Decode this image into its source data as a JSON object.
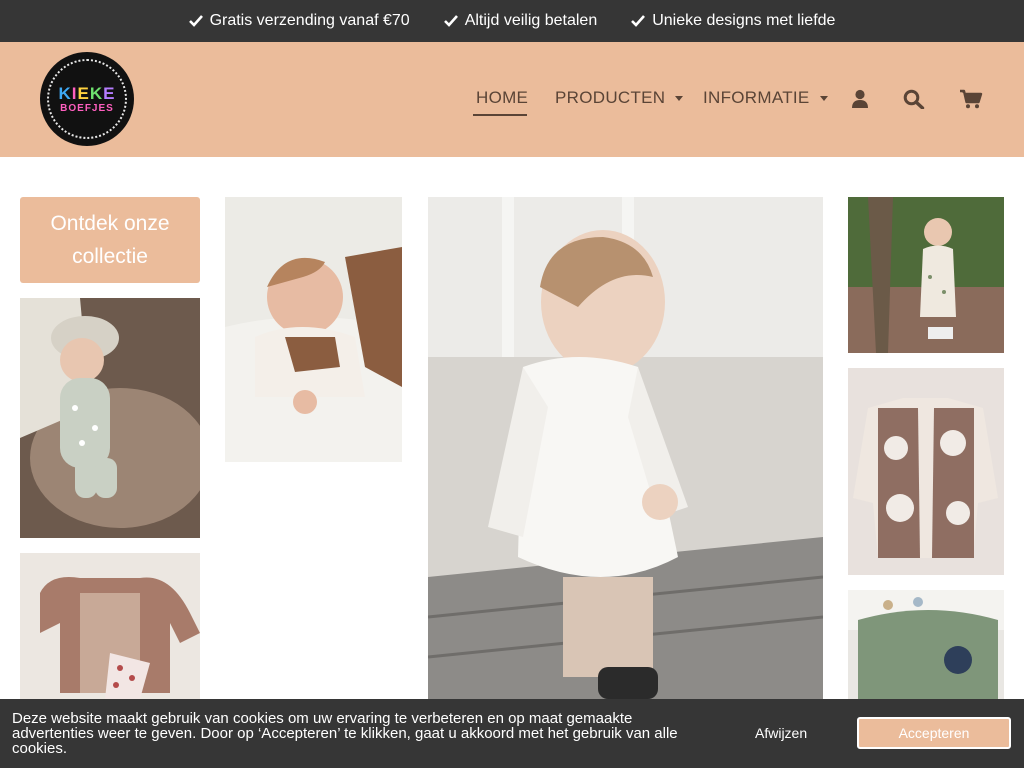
{
  "topbar": {
    "usps": [
      {
        "label": "Gratis verzending vanaf €70",
        "icon": "check-icon"
      },
      {
        "label": "Altijd veilig betalen",
        "icon": "check-icon"
      },
      {
        "label": "Unieke designs met liefde",
        "icon": "check-icon"
      }
    ]
  },
  "header": {
    "logo": {
      "line1": "KIEKE",
      "line2": "BOEFJES"
    },
    "nav": [
      {
        "label": "HOME",
        "active": true
      },
      {
        "label": "PRODUCTEN",
        "has_dropdown": true
      },
      {
        "label": "INFORMATIE",
        "has_dropdown": true
      }
    ],
    "icons": [
      "user-icon",
      "search-icon",
      "cart-icon"
    ]
  },
  "main": {
    "cta_label": "Ontdek onze collectie",
    "photos": [
      {
        "name": "photo-baby-sleeping-floral"
      },
      {
        "name": "photo-baby-crawling"
      },
      {
        "name": "photo-girl-standing"
      },
      {
        "name": "photo-girl-tree"
      },
      {
        "name": "photo-flower-vest"
      },
      {
        "name": "photo-outfit-flatlay"
      },
      {
        "name": "photo-green-set"
      }
    ]
  },
  "cookie": {
    "text": "Deze website maakt gebruik van cookies om uw ervaring te verbeteren en op maat gemaakte advertenties weer te geven. Door op ‘Accepteren’ te klikken, gaat u akkoord met het gebruik van alle cookies.",
    "decline_label": "Afwijzen",
    "accept_label": "Accepteren"
  },
  "colors": {
    "accent": "#ebbc9b",
    "dark": "#363636",
    "nav_text": "#5a4436"
  }
}
